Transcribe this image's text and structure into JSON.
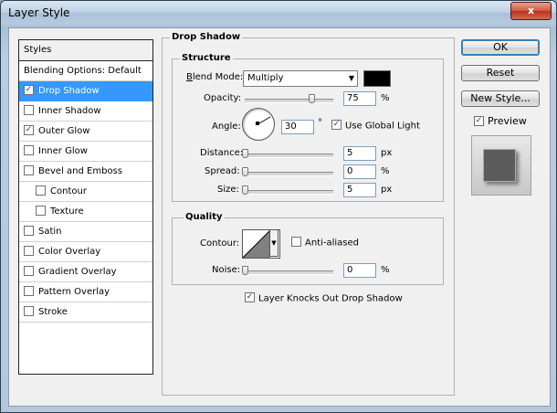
{
  "window": {
    "title": "Layer Style",
    "close_glyph": "x"
  },
  "styles_panel": {
    "header": "Styles",
    "items": [
      {
        "label": "Blending Options: Default",
        "has_checkbox": false,
        "checked": false,
        "selected": false,
        "sub": false
      },
      {
        "label": "Drop Shadow",
        "has_checkbox": true,
        "checked": true,
        "selected": true,
        "sub": false
      },
      {
        "label": "Inner Shadow",
        "has_checkbox": true,
        "checked": false,
        "selected": false,
        "sub": false
      },
      {
        "label": "Outer Glow",
        "has_checkbox": true,
        "checked": true,
        "selected": false,
        "sub": false
      },
      {
        "label": "Inner Glow",
        "has_checkbox": true,
        "checked": false,
        "selected": false,
        "sub": false
      },
      {
        "label": "Bevel and Emboss",
        "has_checkbox": true,
        "checked": false,
        "selected": false,
        "sub": false
      },
      {
        "label": "Contour",
        "has_checkbox": true,
        "checked": false,
        "selected": false,
        "sub": true
      },
      {
        "label": "Texture",
        "has_checkbox": true,
        "checked": false,
        "selected": false,
        "sub": true
      },
      {
        "label": "Satin",
        "has_checkbox": true,
        "checked": false,
        "selected": false,
        "sub": false
      },
      {
        "label": "Color Overlay",
        "has_checkbox": true,
        "checked": false,
        "selected": false,
        "sub": false
      },
      {
        "label": "Gradient Overlay",
        "has_checkbox": true,
        "checked": false,
        "selected": false,
        "sub": false
      },
      {
        "label": "Pattern Overlay",
        "has_checkbox": true,
        "checked": false,
        "selected": false,
        "sub": false
      },
      {
        "label": "Stroke",
        "has_checkbox": true,
        "checked": false,
        "selected": false,
        "sub": false
      }
    ]
  },
  "drop_shadow": {
    "title": "Drop Shadow",
    "structure": {
      "title": "Structure",
      "blend_mode_label": "Blend Mode:",
      "blend_mode_value": "Multiply",
      "shadow_color": "#000000",
      "opacity_label": "Opacity:",
      "opacity_value": "75",
      "opacity_unit": "%",
      "angle_label": "Angle:",
      "angle_value": "30",
      "angle_unit": "°",
      "use_global_light_label": "Use Global Light",
      "use_global_light_checked": true,
      "distance_label": "Distance:",
      "distance_value": "5",
      "distance_unit": "px",
      "spread_label": "Spread:",
      "spread_value": "0",
      "spread_unit": "%",
      "size_label": "Size:",
      "size_value": "5",
      "size_unit": "px"
    },
    "quality": {
      "title": "Quality",
      "contour_label": "Contour:",
      "anti_aliased_label": "Anti-aliased",
      "anti_aliased_checked": false,
      "noise_label": "Noise:",
      "noise_value": "0",
      "noise_unit": "%"
    },
    "knockout_label": "Layer Knocks Out Drop Shadow",
    "knockout_checked": true
  },
  "buttons": {
    "ok": "OK",
    "reset": "Reset",
    "new_style": "New Style...",
    "preview_label": "Preview",
    "preview_checked": true
  },
  "slider_levels": {
    "opacity": 0.75,
    "distance": 0.0,
    "spread": 0.0,
    "size": 0.0,
    "noise": 0.0
  }
}
